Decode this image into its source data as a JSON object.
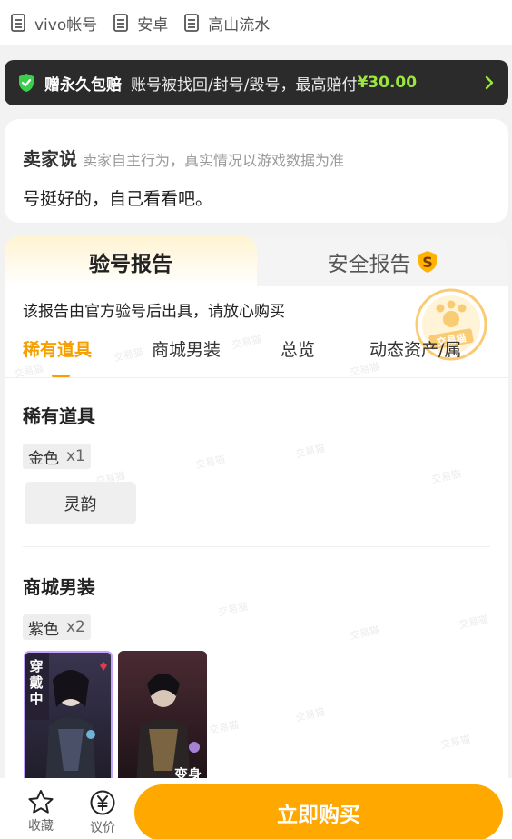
{
  "tags": [
    {
      "icon": "document-icon",
      "label": "vivo帐号"
    },
    {
      "icon": "document-icon",
      "label": "安卓"
    },
    {
      "icon": "document-icon",
      "label": "高山流水"
    }
  ],
  "banner": {
    "title": "赠永久包赔",
    "text": "账号被找回/封号/毁号，最高赔付",
    "amount": "¥30.00"
  },
  "seller": {
    "title": "卖家说",
    "note": "卖家自主行为，真实情况以游戏数据为准",
    "message": "号挺好的，自己看看吧。"
  },
  "report": {
    "tab_active": "验号报告",
    "tab_other": "安全报告",
    "note": "该报告由官方验号后出具，请放心购买",
    "stamp_text": "交易猫",
    "subtabs": [
      "稀有道具",
      "商城男装",
      "总览",
      "动态资产/属"
    ],
    "sections": [
      {
        "title": "稀有道具",
        "grade": "金色",
        "count": "x1",
        "items": [
          "灵韵"
        ]
      },
      {
        "title": "商城男装",
        "grade": "紫色",
        "count": "x2",
        "card_labels": [
          "穿戴中",
          "变身"
        ]
      }
    ]
  },
  "bottombar": {
    "favorite": "收藏",
    "bargain": "议价",
    "buy": "立即购买"
  },
  "colors": {
    "accent": "#ffa800",
    "active_tab": "#f5a000",
    "banner_bg": "#2b2b2b",
    "banner_amount": "#9be63c"
  }
}
